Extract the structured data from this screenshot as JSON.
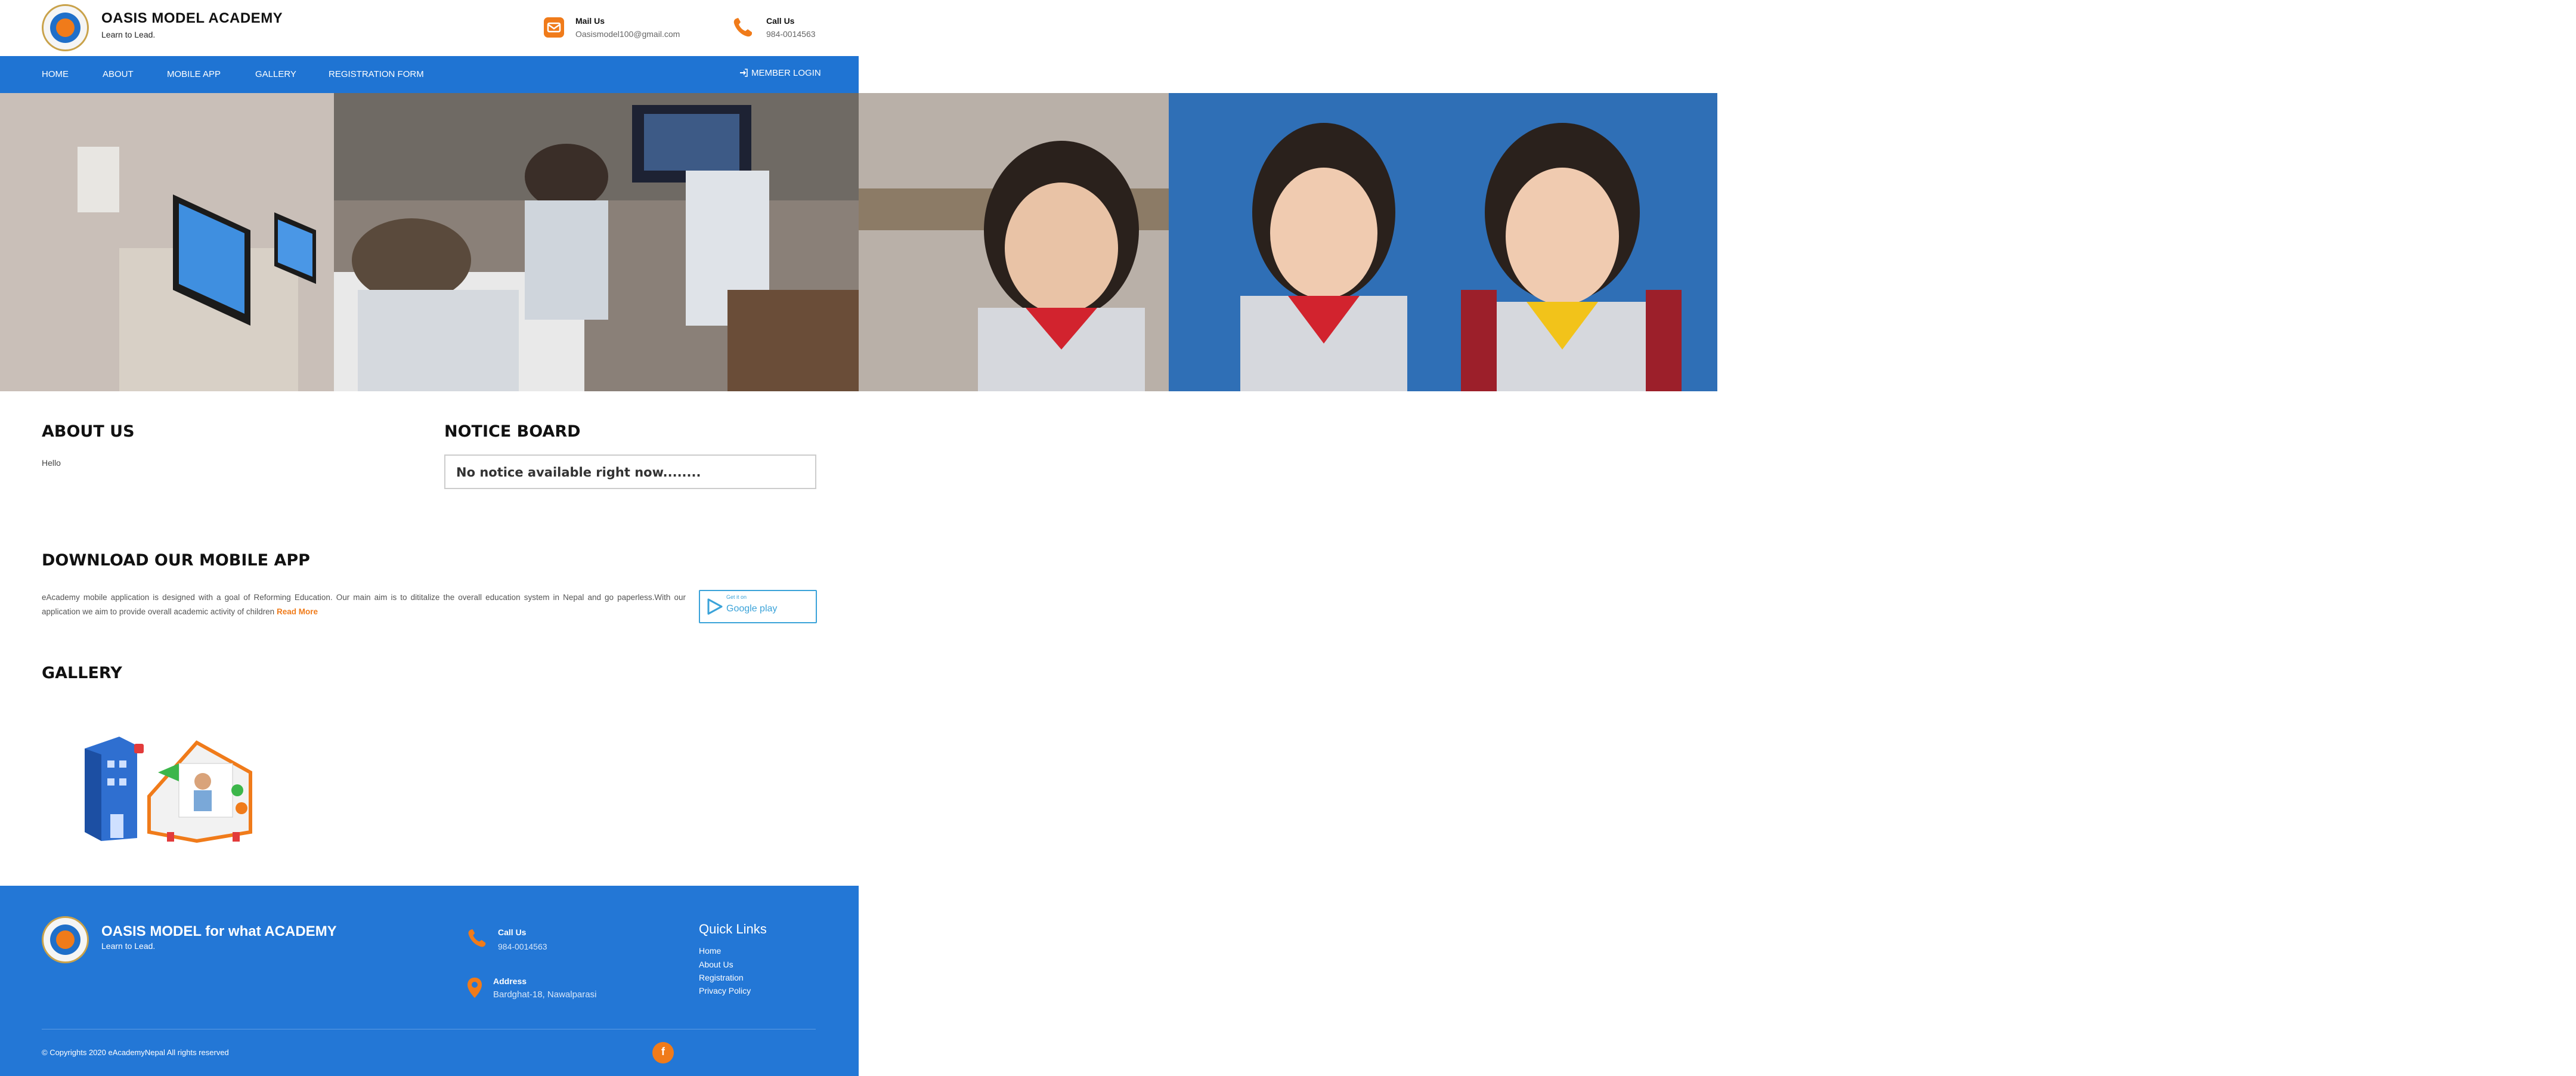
{
  "header": {
    "title": "OASIS MODEL ACADEMY",
    "tagline": "Learn to Lead.",
    "mail_label": "Mail Us",
    "mail_value": "Oasismodel100@gmail.com",
    "call_label": "Call Us",
    "call_value": "984-0014563"
  },
  "nav": {
    "items": [
      "HOME",
      "ABOUT",
      "MOBILE APP",
      "GALLERY",
      "REGISTRATION FORM"
    ],
    "member_login": "MEMBER LOGIN"
  },
  "about": {
    "title": "ABOUT US",
    "text": "Hello"
  },
  "notice": {
    "title": "NOTICE BOARD",
    "text": "No notice available right now........"
  },
  "app": {
    "title": "DOWNLOAD OUR MOBILE APP",
    "description": "eAcademy mobile application is designed with a goal of Reforming Education. Our main aim is to dititalize the overall education system in Nepal and go paperless.With our application we aim to provide overall academic activity of children",
    "read_more": "Read More",
    "store_get": "Get it on",
    "store_name": "Google play"
  },
  "gallery": {
    "title": "GALLERY"
  },
  "footer": {
    "title": "OASIS MODEL for what ACADEMY",
    "tagline": "Learn to Lead.",
    "call_label": "Call Us",
    "call_value": "984-0014563",
    "address_label": "Address",
    "address_value": "Bardghat-18, Nawalparasi",
    "quick_links_title": "Quick Links",
    "quick_links": [
      "Home",
      "About Us",
      "Registration",
      "Privacy Policy"
    ],
    "copyright": "© Copyrights 2020 eAcademyNepal All rights reserved"
  },
  "colors": {
    "nav_blue": "#1f74d3",
    "footer_blue": "#2377d6",
    "accent_orange": "#f07b1a"
  },
  "icons": [
    "mail-icon",
    "phone-icon",
    "login-icon",
    "google-play-icon",
    "location-pin-icon",
    "facebook-icon"
  ]
}
